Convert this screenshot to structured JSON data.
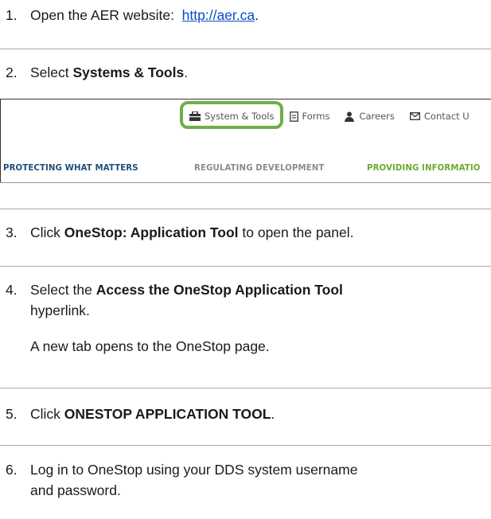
{
  "steps": [
    {
      "num": "1.",
      "pre": "Open the AER website:  ",
      "link": "http://aer.ca",
      "post": "."
    },
    {
      "num": "2.",
      "pre": "Select ",
      "bold": "Systems & Tools",
      "post": "."
    },
    {
      "num": "3.",
      "pre": "Click ",
      "bold": "OneStop: Application Tool",
      "post": " to open the panel."
    },
    {
      "num": "4.",
      "pre": "Select the ",
      "bold": "Access the OneStop Application Tool",
      "line2": "hyperlink.",
      "note": "A new tab opens to the OneStop page."
    },
    {
      "num": "5.",
      "pre": "Click ",
      "bold": "ONESTOP APPLICATION TOOL",
      "post": "."
    },
    {
      "num": "6.",
      "line1": "Log in to OneStop using your DDS system username",
      "line2": "and password."
    }
  ],
  "screenshot": {
    "top_nav": [
      {
        "label": "System & Tools",
        "icon": "briefcase-icon"
      },
      {
        "label": "Forms",
        "icon": "document-icon"
      },
      {
        "label": "Careers",
        "icon": "person-icon"
      },
      {
        "label": "Contact U",
        "icon": "envelope-icon"
      }
    ],
    "main_nav": [
      {
        "label": "PROTECTING WHAT MATTERS",
        "color": "#1f4e79"
      },
      {
        "label": "REGULATING DEVELOPMENT",
        "color": "#8c8c8c"
      },
      {
        "label": "PROVIDING INFORMATIO",
        "color": "#6aaa2f"
      }
    ],
    "highlight_color": "#70ad47"
  },
  "colors": {
    "link": "#0b4cc7",
    "rule": "#a6a6a6"
  }
}
